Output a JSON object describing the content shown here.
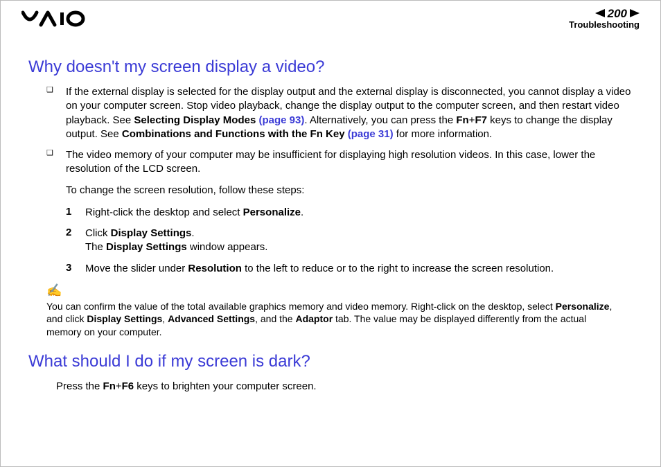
{
  "header": {
    "page_number": "200",
    "section": "Troubleshooting"
  },
  "h1": "Why doesn't my screen display a video?",
  "b1a": "If the external display is selected for the display output and the external display is disconnected, you cannot display a video on your computer screen. Stop video playback, change the display output to the computer screen, and then restart video playback. See ",
  "b1b": "Selecting Display Modes ",
  "b1c": "(page 93)",
  "b1d": ". Alternatively, you can press the ",
  "b1e": "Fn",
  "b1f": "+",
  "b1g": "F7",
  "b1h": " keys to change the display output. See ",
  "b1i": "Combinations and Functions with the Fn Key ",
  "b1j": "(page 31)",
  "b1k": " for more information.",
  "b2": "The video memory of your computer may be insufficient for displaying high resolution videos. In this case, lower the resolution of the LCD screen.",
  "intro": "To change the screen resolution, follow these steps:",
  "s1a": "Right-click the desktop and select ",
  "s1b": "Personalize",
  "s1c": ".",
  "s2a": "Click ",
  "s2b": "Display Settings",
  "s2c": ".",
  "s2d": "The ",
  "s2e": "Display Settings",
  "s2f": " window appears.",
  "s3a": "Move the slider under ",
  "s3b": "Resolution",
  "s3c": " to the left to reduce or to the right to increase the screen resolution.",
  "note1": "You can confirm the value of the total available graphics memory and video memory. Right-click on the desktop, select ",
  "note2": "Personalize",
  "note3": ", and click ",
  "note4": "Display Settings",
  "note5": ", ",
  "note6": "Advanced Settings",
  "note7": ", and the ",
  "note8": "Adaptor",
  "note9": " tab. The value may be displayed differently from the actual memory on your computer.",
  "h2": "What should I do if my screen is dark?",
  "p2a": "Press the ",
  "p2b": "Fn",
  "p2c": "+",
  "p2d": "F6",
  "p2e": " keys to brighten your computer screen."
}
